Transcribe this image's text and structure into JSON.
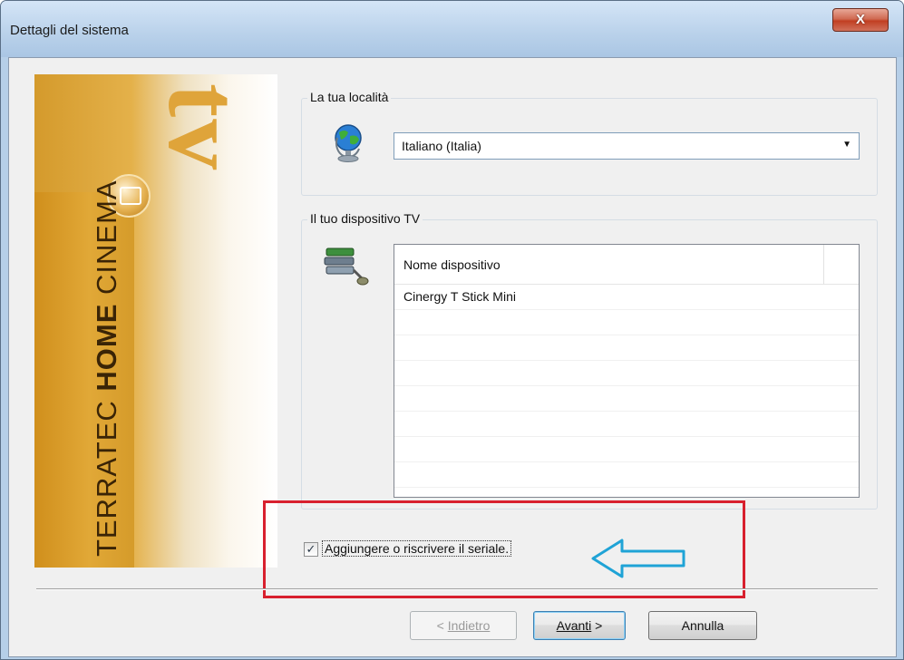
{
  "window": {
    "title": "Dettagli del sistema",
    "close_label": "X"
  },
  "banner": {
    "tv_text": "tv",
    "brand_prefix": "TERRATEC ",
    "brand_bold": "HOME",
    "brand_suffix": " CINEMA"
  },
  "locality": {
    "group_label": "La tua località",
    "selected": "Italiano (Italia)",
    "icon": "globe-icon"
  },
  "device": {
    "group_label": "Il tuo dispositivo TV",
    "icon": "device-tuner-icon",
    "column_header": "Nome dispositivo",
    "rows": [
      "Cinergy T Stick Mini"
    ]
  },
  "serial": {
    "checked": true,
    "label": "Aggiungere o riscrivere il seriale."
  },
  "annotation": {
    "box_color": "#d8202e",
    "arrow_color": "#1fa3d6"
  },
  "buttons": {
    "back_prefix": "< ",
    "back_label": "Indietro",
    "next_label": "Avanti",
    "next_suffix": " >",
    "cancel_label": "Annulla"
  }
}
